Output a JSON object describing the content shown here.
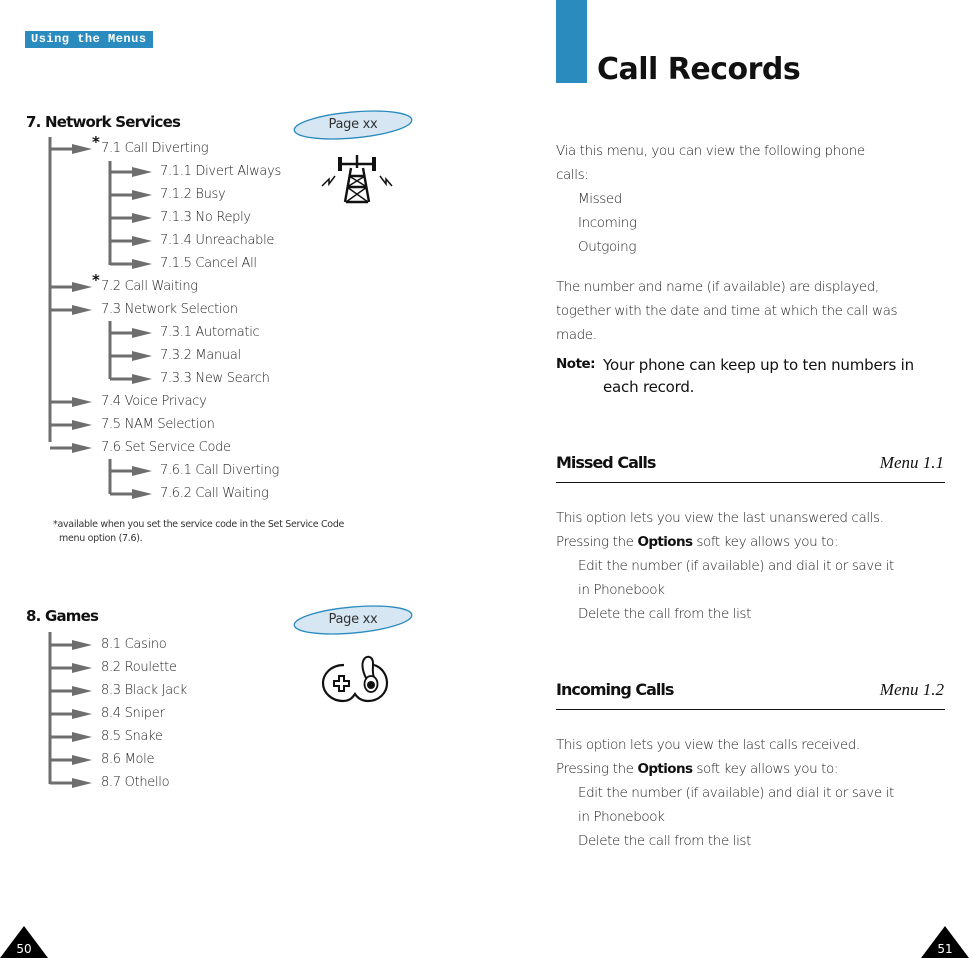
{
  "left_page": {
    "section_tab": "Using the Menus",
    "network": {
      "heading": "7. Network Services",
      "page_ref": "Page xx",
      "icon": "transmission-tower-icon",
      "items": [
        {
          "label": "7.1  Call Diverting",
          "starred": true
        },
        {
          "label": "7.1.1  Divert Always"
        },
        {
          "label": "7.1.2  Busy"
        },
        {
          "label": "7.1.3  No Reply"
        },
        {
          "label": "7.1.4  Unreachable"
        },
        {
          "label": "7.1.5  Cancel All"
        },
        {
          "label": "7.2  Call Waiting",
          "starred": true
        },
        {
          "label": "7.3  Network Selection"
        },
        {
          "label": "7.3.1  Automatic"
        },
        {
          "label": "7.3.2  Manual"
        },
        {
          "label": "7.3.3  New Search"
        },
        {
          "label": "7.4  Voice Privacy"
        },
        {
          "label": "7.5  NAM Selection"
        },
        {
          "label": "7.6  Set Service Code"
        },
        {
          "label": "7.6.1  Call Diverting"
        },
        {
          "label": "7.6.2  Call Waiting"
        }
      ],
      "star": "*",
      "footnote_line1": "*available when you set the service code in the Set Service Code",
      "footnote_line2": "menu option (7.6)."
    },
    "games": {
      "heading": "8. Games",
      "page_ref": "Page xx",
      "icon": "gamepad-icon",
      "items": [
        {
          "label": "8.1  Casino"
        },
        {
          "label": "8.2  Roulette"
        },
        {
          "label": "8.3  Black Jack"
        },
        {
          "label": "8.4  Sniper"
        },
        {
          "label": "8.5  Snake"
        },
        {
          "label": "8.6  Mole"
        },
        {
          "label": "8.7  Othello"
        }
      ]
    },
    "page_number": "50"
  },
  "right_page": {
    "title": "Call Records",
    "intro_line1": "Via this menu, you can view the following phone",
    "intro_line2": "calls:",
    "call_types": [
      "Missed",
      "Incoming",
      "Outgoing"
    ],
    "para_line1": "The number and name (if available) are displayed,",
    "para_line2": "together with the date and time at which the call was",
    "para_line3": "made.",
    "note_label": "Note:",
    "note_line1": "Your phone can keep up to ten numbers in",
    "note_line2": "each record.",
    "sections": [
      {
        "heading": "Missed Calls",
        "menu": "Menu 1.1",
        "line1": "This option lets you view the last unanswered calls.",
        "pressing_prefix": "Pressing the ",
        "pressing_bold": "Options",
        "pressing_suffix": " soft key allows you to:",
        "bullet1_line1": "Edit the number (if available) and dial it or save it",
        "bullet1_line2": "in Phonebook",
        "bullet2": "Delete the call from the list"
      },
      {
        "heading": "Incoming Calls",
        "menu": "Menu 1.2",
        "line1": "This option lets you view the last calls received.",
        "pressing_prefix": "Pressing the ",
        "pressing_bold": "Options",
        "pressing_suffix": " soft key allows you to:",
        "bullet1_line1": "Edit the number (if available) and dial it or save it",
        "bullet1_line2": "in Phonebook",
        "bullet2": "Delete the call from the list"
      }
    ],
    "page_number": "51"
  },
  "colors": {
    "accent": "#2a8bbf",
    "page_ref_fill": "#d6e6f2",
    "tree_line": "#6e6e6e"
  }
}
